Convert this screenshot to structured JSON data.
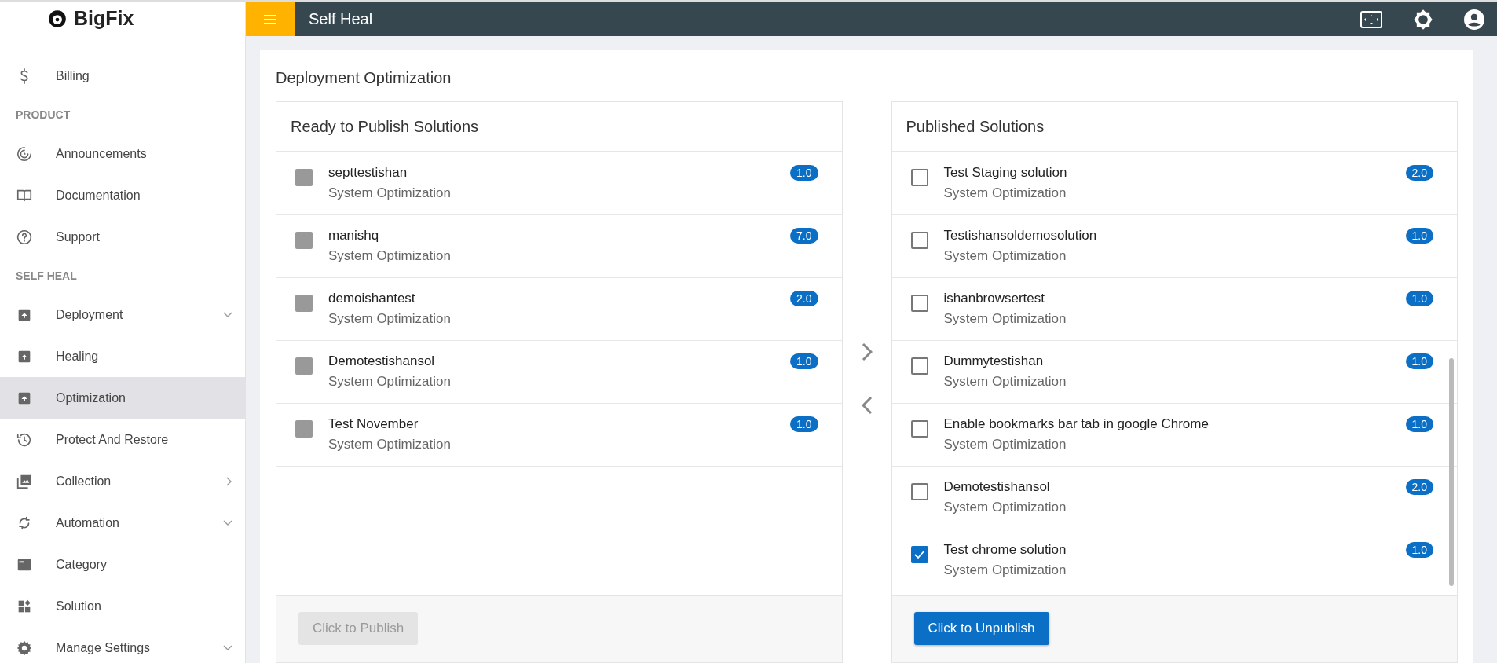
{
  "brand": "BigFix",
  "sidebar": {
    "items": [
      {
        "kind": "link",
        "label": "Billing",
        "selected": false,
        "has_submenu": false
      },
      {
        "kind": "section",
        "label": "PRODUCT"
      },
      {
        "kind": "link",
        "label": "Announcements",
        "selected": false,
        "has_submenu": false
      },
      {
        "kind": "link",
        "label": "Documentation",
        "selected": false,
        "has_submenu": false
      },
      {
        "kind": "link",
        "label": "Support",
        "selected": false,
        "has_submenu": false
      },
      {
        "kind": "section",
        "label": "SELF HEAL"
      },
      {
        "kind": "link",
        "label": "Deployment",
        "selected": false,
        "has_submenu": true,
        "expanded": true
      },
      {
        "kind": "link",
        "label": "Healing",
        "selected": false,
        "has_submenu": false
      },
      {
        "kind": "link",
        "label": "Optimization",
        "selected": true,
        "has_submenu": false
      },
      {
        "kind": "link",
        "label": "Protect And Restore",
        "selected": false,
        "has_submenu": false
      },
      {
        "kind": "link",
        "label": "Collection",
        "selected": false,
        "has_submenu": true,
        "expanded": false
      },
      {
        "kind": "link",
        "label": "Automation",
        "selected": false,
        "has_submenu": true,
        "expanded": true
      },
      {
        "kind": "link",
        "label": "Category",
        "selected": false,
        "has_submenu": false
      },
      {
        "kind": "link",
        "label": "Solution",
        "selected": false,
        "has_submenu": false
      },
      {
        "kind": "link",
        "label": "Manage Settings",
        "selected": false,
        "has_submenu": true,
        "expanded": true
      }
    ]
  },
  "header": {
    "title": "Self Heal"
  },
  "page": {
    "title": "Deployment Optimization"
  },
  "panels": [
    {
      "title": "Ready to Publish Solutions",
      "button": {
        "label": "Click to Publish",
        "disabled": true
      },
      "scrollbar": false,
      "items": [
        {
          "name": "septtestishan",
          "category": "System Optimization",
          "version": "1.0",
          "checked": false,
          "disabled": true
        },
        {
          "name": "manishq",
          "category": "System Optimization",
          "version": "7.0",
          "checked": false,
          "disabled": true
        },
        {
          "name": "demoishantest",
          "category": "System Optimization",
          "version": "2.0",
          "checked": false,
          "disabled": true
        },
        {
          "name": "Demotestishansol",
          "category": "System Optimization",
          "version": "1.0",
          "checked": false,
          "disabled": true
        },
        {
          "name": "Test November",
          "category": "System Optimization",
          "version": "1.0",
          "checked": false,
          "disabled": true
        }
      ]
    },
    {
      "title": "Published Solutions",
      "button": {
        "label": "Click to Unpublish",
        "disabled": false
      },
      "scrollbar": true,
      "items": [
        {
          "name": "Test Staging solution",
          "category": "System Optimization",
          "version": "2.0",
          "checked": false,
          "disabled": false
        },
        {
          "name": "Testishansoldemosolution",
          "category": "System Optimization",
          "version": "1.0",
          "checked": false,
          "disabled": false
        },
        {
          "name": "ishanbrowsertest",
          "category": "System Optimization",
          "version": "1.0",
          "checked": false,
          "disabled": false
        },
        {
          "name": "Dummytestishan",
          "category": "System Optimization",
          "version": "1.0",
          "checked": false,
          "disabled": false
        },
        {
          "name": "Enable bookmarks bar tab in google Chrome",
          "category": "System Optimization",
          "version": "1.0",
          "checked": false,
          "disabled": false
        },
        {
          "name": "Demotestishansol",
          "category": "System Optimization",
          "version": "2.0",
          "checked": false,
          "disabled": false
        },
        {
          "name": "Test chrome solution",
          "category": "System Optimization",
          "version": "1.0",
          "checked": true,
          "disabled": false
        }
      ]
    }
  ]
}
